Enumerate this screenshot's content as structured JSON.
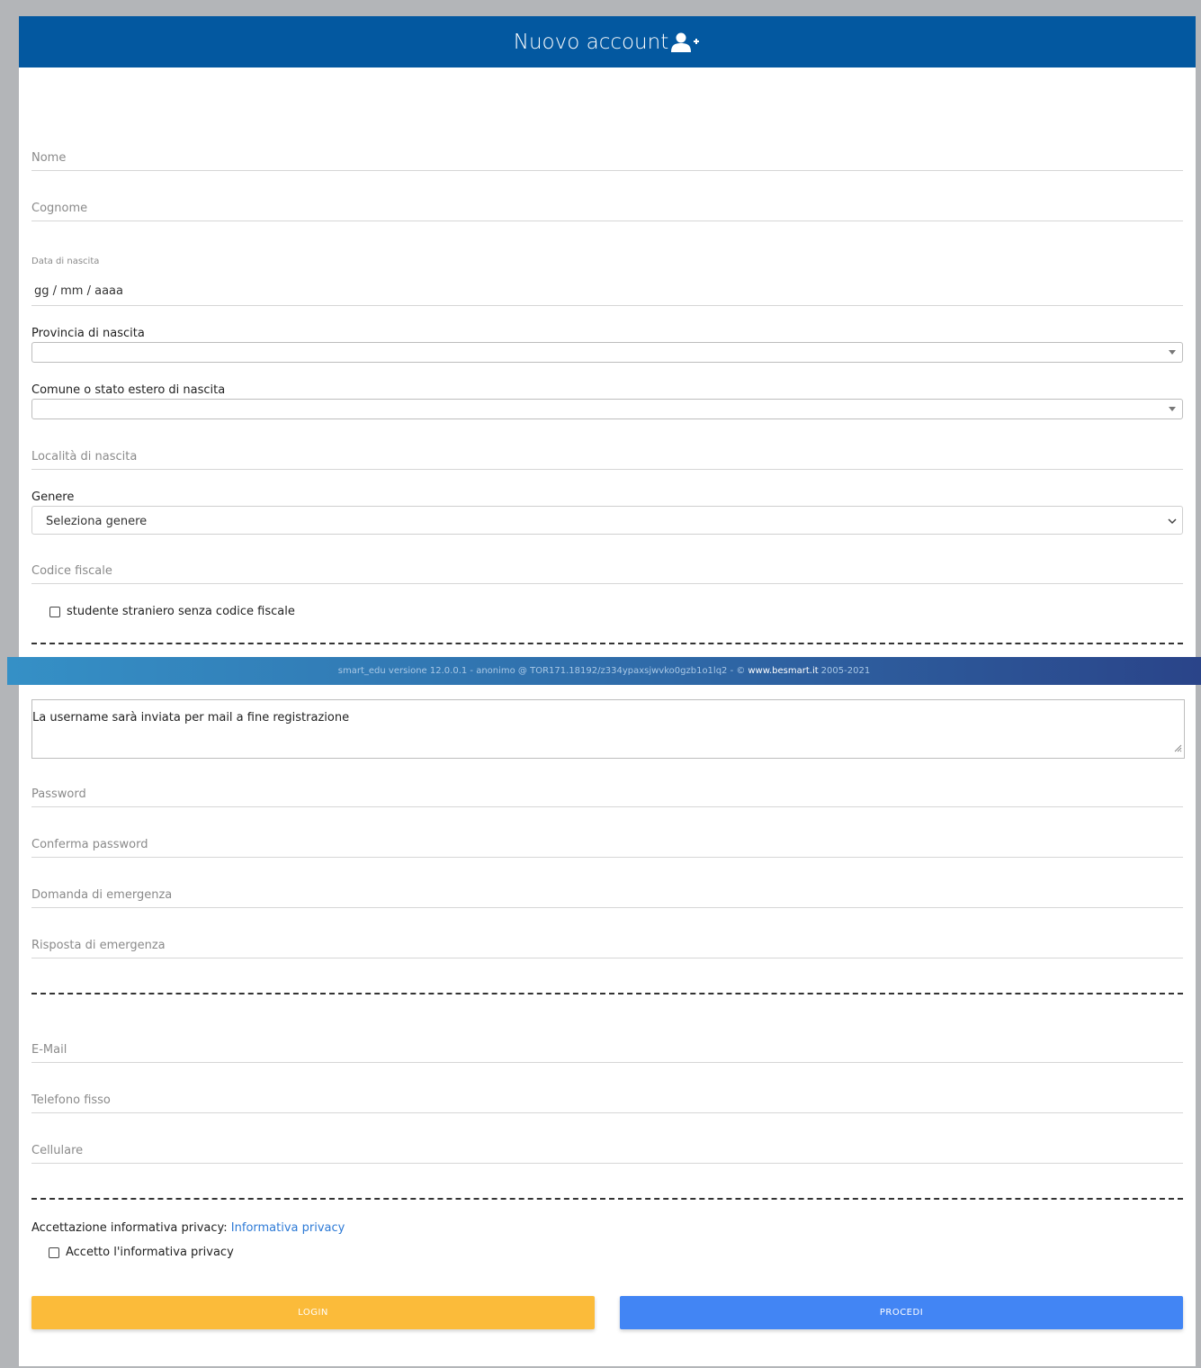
{
  "header": {
    "title": "Nuovo account",
    "icon": "user-plus-icon"
  },
  "anagrafica": {
    "nome_placeholder": "Nome",
    "cognome_placeholder": "Cognome",
    "data_nascita_label": "Data di nascita",
    "data_nascita_value": "gg / mm / aaaa",
    "provincia_label": "Provincia di nascita",
    "comune_label": "Comune o stato estero di nascita",
    "localita_placeholder": "Località di nascita",
    "genere_label": "Genere",
    "genere_selected": "Seleziona genere",
    "codice_fiscale_placeholder": "Codice fiscale",
    "straniero_checkbox_label": "studente straniero senza codice fiscale"
  },
  "footer": {
    "version_text": "smart_edu versione 12.0.0.1 - anonimo @ TOR171.18192/z334ypaxsjwvko0gzb1o1lq2 - ©",
    "site": "www.besmart.it",
    "years": "2005-2021"
  },
  "credenziali": {
    "username_note": "La username sarà inviata per mail a fine registrazione",
    "password_placeholder": "Password",
    "conferma_password_placeholder": "Conferma password",
    "domanda_placeholder": "Domanda di emergenza",
    "risposta_placeholder": "Risposta di emergenza"
  },
  "contatti": {
    "email_placeholder": "E-Mail",
    "telefono_placeholder": "Telefono fisso",
    "cellulare_placeholder": "Cellulare"
  },
  "privacy": {
    "label": "Accettazione informativa privacy:",
    "link_text": "Informativa privacy",
    "checkbox_label": "Accetto l'informativa privacy"
  },
  "buttons": {
    "login": "LOGIN",
    "procedi": "PROCEDI"
  },
  "colors": {
    "header": "#0358a0",
    "login": "#fbbb3a",
    "procedi": "#4285f4",
    "link": "#2d7ad6"
  }
}
